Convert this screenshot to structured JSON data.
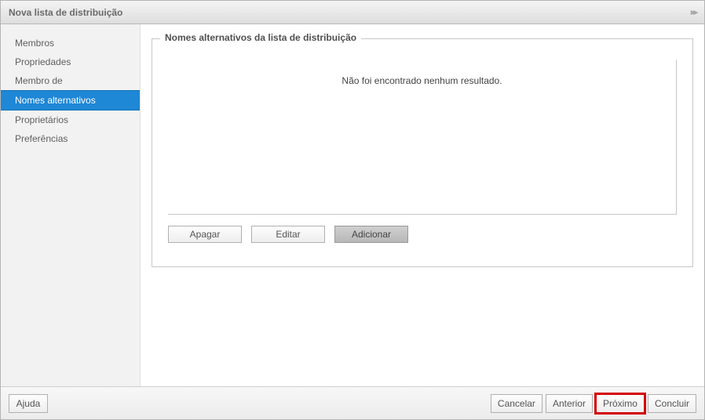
{
  "titlebar": {
    "title": "Nova lista de distribuição"
  },
  "sidebar": {
    "items": [
      {
        "label": "Membros"
      },
      {
        "label": "Propriedades"
      },
      {
        "label": "Membro de"
      },
      {
        "label": "Nomes alternativos"
      },
      {
        "label": "Proprietários"
      },
      {
        "label": "Preferências"
      }
    ],
    "active_index": 3
  },
  "fieldset": {
    "legend": "Nomes alternativos da lista de distribuição",
    "no_results": "Não foi encontrado nenhum resultado.",
    "buttons": {
      "delete": "Apagar",
      "edit": "Editar",
      "add": "Adicionar"
    }
  },
  "footer": {
    "help": "Ajuda",
    "cancel": "Cancelar",
    "previous": "Anterior",
    "next": "Próximo",
    "finish": "Concluir"
  }
}
